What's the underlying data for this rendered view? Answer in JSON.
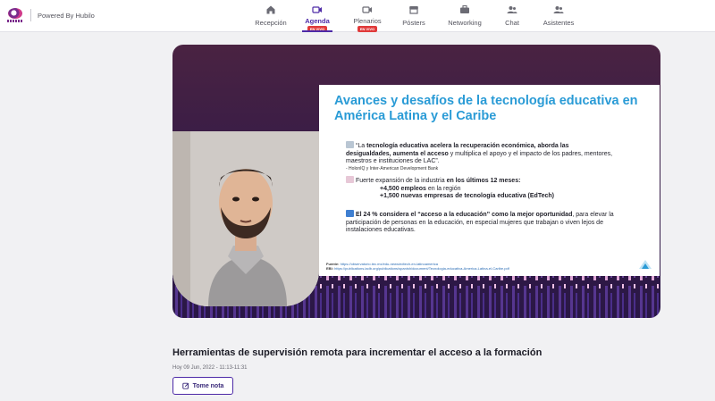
{
  "header": {
    "powered_by": "Powered By Hubilo"
  },
  "nav": [
    {
      "label": "Recepción",
      "icon": "home-icon"
    },
    {
      "label": "Agenda",
      "icon": "video-camera-icon",
      "badge": "EN VIVO",
      "active": true
    },
    {
      "label": "Plenarios",
      "icon": "video-camera-icon",
      "badge": "EN VIVO"
    },
    {
      "label": "Pósters",
      "icon": "store-icon"
    },
    {
      "label": "Networking",
      "icon": "briefcase-icon"
    },
    {
      "label": "Chat",
      "icon": "people-icon"
    },
    {
      "label": "Asistentes",
      "icon": "people-icon"
    }
  ],
  "slide": {
    "title": "Avances y desafíos de la tecnología educativa en América Latina y el Caribe",
    "quote_lead": "“La ",
    "quote_bold1": "tecnología educativa acelera la recuperación económica, aborda las desigualdades, aumenta el acceso",
    "quote_rest": " y multiplica el apoyo y el impacto de los padres, mentores, maestros e instituciones de LAC”.",
    "quote_source": "- HolonIQ y  Inter-American Development Bank",
    "growth_lead": "Fuerte expansión de la industria ",
    "growth_bold": "en los últimos 12 meses:",
    "growth_line1_bold": "+4,500 empleos",
    "growth_line1_rest": " en la región",
    "growth_line2": "+1,500 nuevas empresas de tecnología educativa (EdTech)",
    "access_bold1": "El 24 % considera el “acceso a la educación” como la mejor oportunidad",
    "access_rest": ", para elevar la participación de personas en la educación, en especial mujeres que trabajan o viven lejos de instalaciones educativas.",
    "source_label1": "Fuente:",
    "source_url1": "https://observatorio.tec.mx/edu-news/edtech-en-latinoamerica",
    "source_label2": "EBI:",
    "source_url2": "https://publications.iadb.org/publications/spanish/document/Tecnologia-educativa-America-Latina-el-Caribe.pdf"
  },
  "session": {
    "title": "Herramientas de supervisión remota para incrementar el acceso a la formación",
    "time": "Hoy 09 Jun, 2022 - 11:13-11:31",
    "note_button": "Tome nota"
  },
  "colors": {
    "accent": "#4d2aa7",
    "live": "#e03a3a",
    "slide_title": "#2a9bd6"
  }
}
